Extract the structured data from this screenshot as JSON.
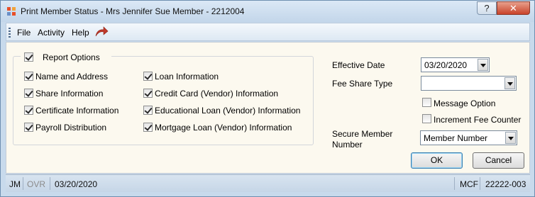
{
  "window": {
    "title": "Print Member Status - Mrs Jennifer Sue Member - 2212004",
    "help_label": "?",
    "close_label": "✕"
  },
  "menu": {
    "items": [
      "File",
      "Activity",
      "Help"
    ]
  },
  "report_options": {
    "group_label": "Report Options",
    "group_checked": true,
    "left_options": [
      {
        "label": "Name and Address",
        "checked": true
      },
      {
        "label": "Share Information",
        "checked": true
      },
      {
        "label": "Certificate Information",
        "checked": true
      },
      {
        "label": "Payroll Distribution",
        "checked": true
      }
    ],
    "right_options": [
      {
        "label": "Loan Information",
        "checked": true
      },
      {
        "label": "Credit Card (Vendor) Information",
        "checked": true
      },
      {
        "label": "Educational Loan (Vendor) Information",
        "checked": true
      },
      {
        "label": "Mortgage Loan (Vendor) Information",
        "checked": true
      }
    ]
  },
  "fields": {
    "effective_date_label": "Effective Date",
    "effective_date_value": "03/20/2020",
    "fee_share_type_label": "Fee Share Type",
    "fee_share_type_value": "",
    "message_option_label": "Message Option",
    "message_option_checked": false,
    "increment_fee_label": "Increment Fee Counter",
    "increment_fee_checked": false,
    "secure_member_label_line1": "Secure Member",
    "secure_member_label_line2": "Number",
    "secure_member_value": "Member Number"
  },
  "buttons": {
    "ok": "OK",
    "cancel": "Cancel"
  },
  "status": {
    "user": "JM",
    "mode": "OVR",
    "date": "03/20/2020",
    "code": "MCF",
    "account": "22222-003"
  },
  "colors": {
    "content_bg": "#fcf9ef",
    "chrome_bg": "#c8daec",
    "redo_arrow": "#c0392b"
  }
}
